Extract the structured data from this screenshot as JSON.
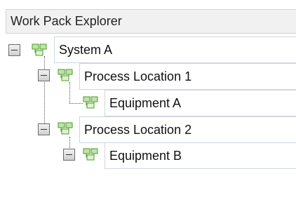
{
  "panel": {
    "title": "Work Pack Explorer"
  },
  "tree": {
    "nodes": [
      {
        "label": "System A",
        "expanded": true
      },
      {
        "label": "Process Location 1",
        "expanded": true
      },
      {
        "label": "Equipment A"
      },
      {
        "label": "Process Location 2",
        "expanded": true
      },
      {
        "label": "Equipment B",
        "expanded": true
      }
    ]
  },
  "icons": {
    "node": "hierarchy-node-icon",
    "collapse": "collapse-minus-icon"
  },
  "colors": {
    "icon_green": "#4f9b2e",
    "label_border": "#cfd6e0"
  }
}
